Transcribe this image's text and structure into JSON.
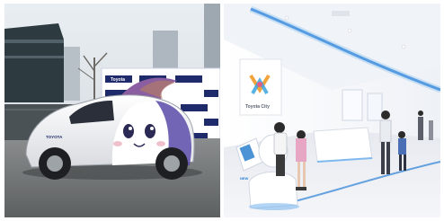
{
  "images": [
    {
      "id": "left",
      "banner_text": "Toyota",
      "car_badge_text": "TOYOTA"
    },
    {
      "id": "right",
      "logo_text": "Toyota City",
      "kiosk_label": "NEW"
    }
  ],
  "colors": {
    "sky": "#d7dde2",
    "banner_blue": "#1f2a6b",
    "car_white": "#f3f3f5",
    "mascot_purple": "#5a4aa8",
    "floor_blue": "#2a7fd6",
    "interior_white": "#f7f8fb"
  }
}
